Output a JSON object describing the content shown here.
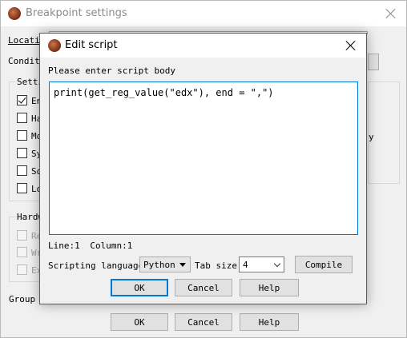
{
  "outer": {
    "title": "Breakpoint settings",
    "location_label": "Location",
    "condition_label": "Conditi",
    "settings_group": "Setti",
    "checkboxes": [
      {
        "label": "En",
        "checked": true
      },
      {
        "label": "Ha",
        "checked": false
      },
      {
        "label": "Mo",
        "checked": false
      },
      {
        "label": "Sy",
        "checked": false
      },
      {
        "label": "So",
        "checked": false
      },
      {
        "label": "Lo",
        "checked": false
      }
    ],
    "right_fragment": "y",
    "hardware_group": "Hardw",
    "hardware_items": [
      "Re",
      "Wr",
      "Ex"
    ],
    "group_label": "Group",
    "buttons": {
      "ok": "OK",
      "cancel": "Cancel",
      "help": "Help"
    }
  },
  "dialog": {
    "title": "Edit script",
    "prompt": "Please enter script body",
    "script": "print(get_reg_value(\"edx\"), end = \",\")",
    "line_label": "Line:1",
    "column_label": "Column:1",
    "scripting_language_label": "Scripting language",
    "scripting_language_value": "Python",
    "tab_size_label": "Tab size",
    "tab_size_value": "4",
    "compile_label": "Compile",
    "buttons": {
      "ok": "OK",
      "cancel": "Cancel",
      "help": "Help"
    }
  },
  "colors": {
    "accent": "#0078d7",
    "window_bg": "#f0f0f0",
    "disabled_text": "#a0a0a0"
  },
  "icons": [
    "app-avatar-icon",
    "close-icon",
    "checkbox-icon",
    "chevron-down-icon"
  ]
}
